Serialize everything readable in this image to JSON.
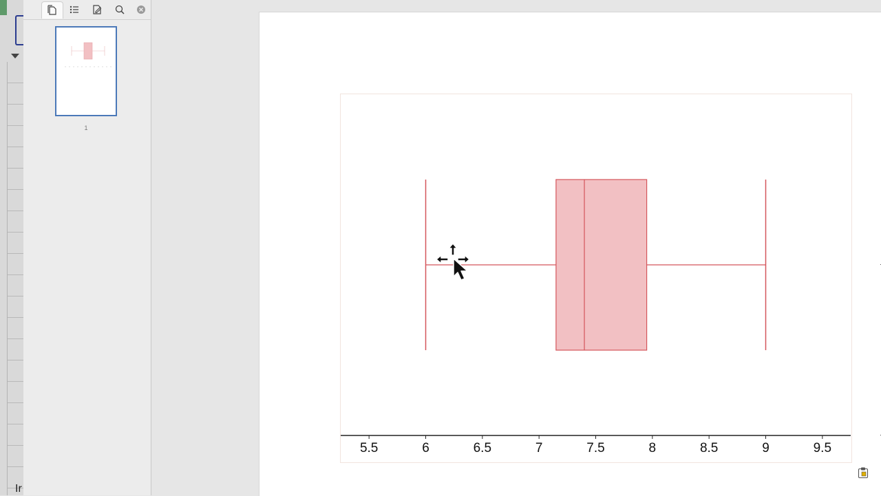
{
  "sidebar": {
    "tabs": [
      {
        "icon": "thumbnails-icon",
        "active": true
      },
      {
        "icon": "outline-list-icon",
        "active": false
      },
      {
        "icon": "annotations-icon",
        "active": false
      },
      {
        "icon": "search-icon",
        "active": false
      },
      {
        "icon": "close-icon",
        "active": false
      }
    ],
    "page_thumbnail_number": "1"
  },
  "background_app": {
    "partial_text": "Ir"
  },
  "chart_data": {
    "type": "boxplot",
    "orientation": "horizontal",
    "title": "",
    "xlabel": "",
    "ylabel": "",
    "xlim": [
      5.25,
      9.75
    ],
    "xticks": [
      5.5,
      6,
      6.5,
      7,
      7.5,
      8,
      8.5,
      9,
      9.5
    ],
    "xtick_labels": [
      "5.5",
      "6",
      "6.5",
      "7",
      "7.5",
      "8",
      "8.5",
      "9",
      "9.5"
    ],
    "box": {
      "min": 6.0,
      "q1": 7.15,
      "median": 7.4,
      "q3": 7.95,
      "max": 9.0
    },
    "colors": {
      "box_fill": "#f2c0c3",
      "line": "#d4555b",
      "axis": "#222222"
    },
    "grid": false,
    "legend": "none"
  }
}
